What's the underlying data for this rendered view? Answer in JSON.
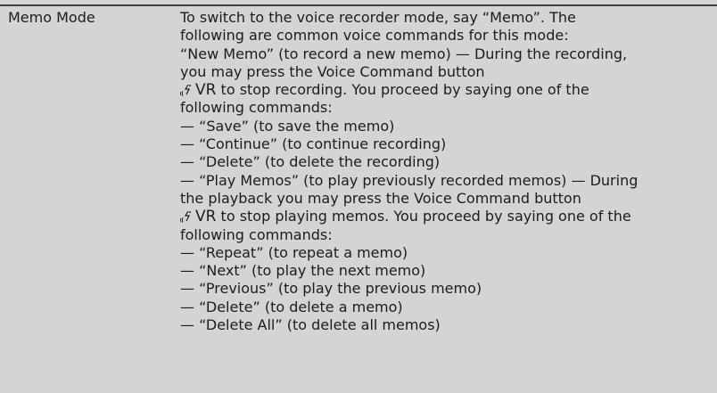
{
  "table": {
    "term": "Memo Mode",
    "intro_lines": [
      "To switch to the voice recorder mode, say “Memo”. The",
      "following are common voice commands for this mode:",
      "“New Memo” (to record a new memo) — During the recording,",
      "you may press the Voice Command button"
    ],
    "vr_key": "VR",
    "stop_recording": " to stop recording. You proceed by saying one of the",
    "after_record_lines": [
      "following commands:",
      "— “Save” (to save the memo)",
      "— “Continue” (to continue recording)",
      "— “Delete” (to delete the recording)",
      "— “Play Memos” (to play previously recorded memos) — During",
      "the playback you may press the Voice Command button"
    ],
    "stop_playing": " to stop playing memos. You proceed by saying one of the",
    "playback_lines": [
      "following commands:",
      "— “Repeat” (to repeat a memo)",
      "— “Next” (to play the next memo)",
      "— “Previous” (to play the previous memo)",
      "— “Delete” (to delete a memo)",
      "— “Delete All” (to delete all memos)"
    ],
    "icon": "voice-command-icon"
  }
}
